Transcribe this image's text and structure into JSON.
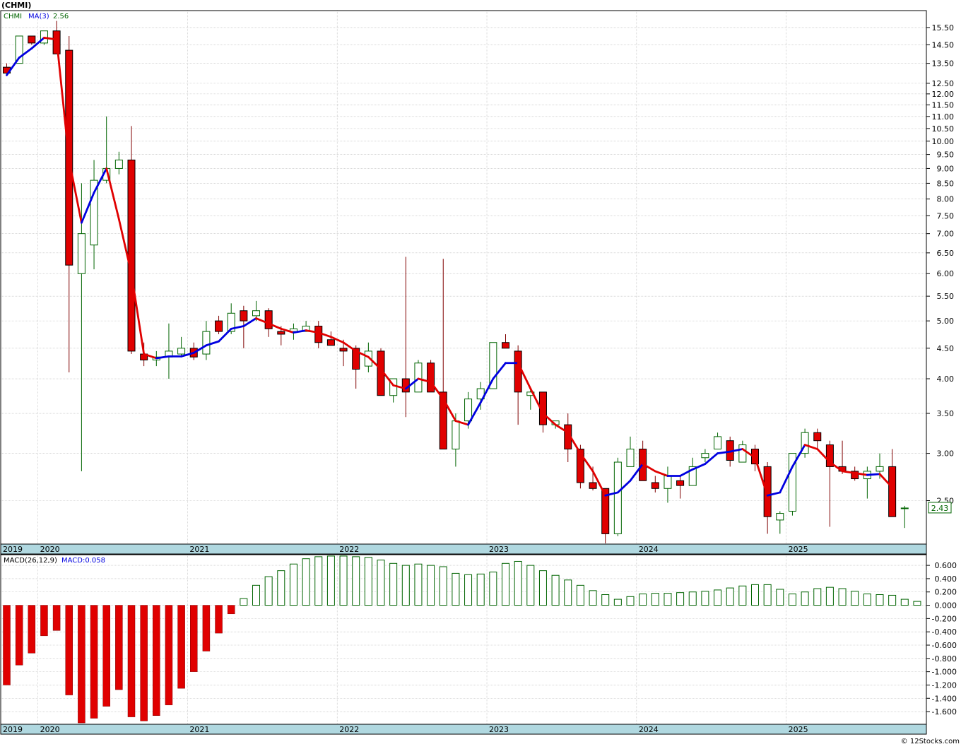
{
  "title": "(CHMI)",
  "price_legend": {
    "symbol": "CHMI",
    "ma_label": "MA(3)",
    "ma_value": "2.56"
  },
  "macd_legend": {
    "label": "MACD(26,12,9)",
    "value_label": "MACD:0.058"
  },
  "last_price": "2.43",
  "watermark": "© 12Stocks.com",
  "colors": {
    "up_body": "#ffffff",
    "up_outline": "#006400",
    "down_body": "#e00000",
    "ma_up": "#0000e0",
    "ma_down": "#e00000",
    "macd_up_outline": "#006400",
    "macd_down": "#e00000",
    "axis_band": "#b0d8e0",
    "grid": "#c0c0c0"
  },
  "chart_data": [
    {
      "type": "candlestick",
      "scale": "log",
      "ylim": [
        2.12,
        16.5
      ],
      "y_ticks": [
        "2.50",
        "3.00",
        "3.50",
        "4.00",
        "4.50",
        "5.00",
        "5.50",
        "6.00",
        "6.50",
        "7.00",
        "7.50",
        "8.00",
        "8.50",
        "9.00",
        "9.50",
        "10.00",
        "10.50",
        "11.00",
        "11.50",
        "12.00",
        "12.50",
        "13.50",
        "14.50",
        "15.50"
      ],
      "x_labels": [
        "2019",
        "2020",
        "2021",
        "2022",
        "2023",
        "2024",
        "2025"
      ],
      "x_label_month_index": [
        0,
        3,
        15,
        27,
        39,
        51,
        63
      ],
      "grid": true,
      "interval": "monthly",
      "candles": [
        [
          13.3,
          13.5,
          13.0,
          13.0
        ],
        [
          13.5,
          15.0,
          13.5,
          15.0
        ],
        [
          15.0,
          15.0,
          14.5,
          14.6
        ],
        [
          14.6,
          15.3,
          14.5,
          15.3
        ],
        [
          15.3,
          15.9,
          14.0,
          14.0
        ],
        [
          14.2,
          15.0,
          4.1,
          6.2
        ],
        [
          6.0,
          8.5,
          2.8,
          7.0
        ],
        [
          6.7,
          9.3,
          6.1,
          8.6
        ],
        [
          8.6,
          11.0,
          8.5,
          9.0
        ],
        [
          9.0,
          9.6,
          8.8,
          9.3
        ],
        [
          9.3,
          10.6,
          4.4,
          4.45
        ],
        [
          4.4,
          4.6,
          4.2,
          4.3
        ],
        [
          4.3,
          4.45,
          4.2,
          4.35
        ],
        [
          4.35,
          4.95,
          4.0,
          4.45
        ],
        [
          4.4,
          4.7,
          4.35,
          4.5
        ],
        [
          4.5,
          4.6,
          4.3,
          4.35
        ],
        [
          4.4,
          5.0,
          4.3,
          4.8
        ],
        [
          5.0,
          5.1,
          4.75,
          4.8
        ],
        [
          4.8,
          5.35,
          4.75,
          5.15
        ],
        [
          5.2,
          5.3,
          4.5,
          5.0
        ],
        [
          5.1,
          5.4,
          5.0,
          5.2
        ],
        [
          5.2,
          5.25,
          4.7,
          4.85
        ],
        [
          4.8,
          4.9,
          4.55,
          4.75
        ],
        [
          4.8,
          4.95,
          4.65,
          4.85
        ],
        [
          4.8,
          5.0,
          4.8,
          4.9
        ],
        [
          4.9,
          5.0,
          4.5,
          4.6
        ],
        [
          4.65,
          4.8,
          4.55,
          4.55
        ],
        [
          4.5,
          4.65,
          4.2,
          4.45
        ],
        [
          4.5,
          4.55,
          3.85,
          4.15
        ],
        [
          4.2,
          4.6,
          4.1,
          4.45
        ],
        [
          4.45,
          4.5,
          3.75,
          3.75
        ],
        [
          3.75,
          4.0,
          3.65,
          4.0
        ],
        [
          4.0,
          6.4,
          3.45,
          3.8
        ],
        [
          3.8,
          4.3,
          3.8,
          4.25
        ],
        [
          4.25,
          4.3,
          3.8,
          3.8
        ],
        [
          3.8,
          6.35,
          3.05,
          3.05
        ],
        [
          3.05,
          3.5,
          2.85,
          3.4
        ],
        [
          3.4,
          3.8,
          3.3,
          3.7
        ],
        [
          3.7,
          3.95,
          3.55,
          3.85
        ],
        [
          3.85,
          4.6,
          3.85,
          4.6
        ],
        [
          4.6,
          4.75,
          4.5,
          4.5
        ],
        [
          4.45,
          4.55,
          3.35,
          3.8
        ],
        [
          3.75,
          3.85,
          3.55,
          3.8
        ],
        [
          3.8,
          3.8,
          3.25,
          3.35
        ],
        [
          3.35,
          3.4,
          3.3,
          3.4
        ],
        [
          3.35,
          3.5,
          2.9,
          3.05
        ],
        [
          3.05,
          3.1,
          2.62,
          2.68
        ],
        [
          2.68,
          2.85,
          2.6,
          2.62
        ],
        [
          2.62,
          2.62,
          2.12,
          2.2
        ],
        [
          2.2,
          2.95,
          2.18,
          2.9
        ],
        [
          2.85,
          3.2,
          2.85,
          3.05
        ],
        [
          3.05,
          3.15,
          2.7,
          2.7
        ],
        [
          2.68,
          2.75,
          2.58,
          2.62
        ],
        [
          2.62,
          2.85,
          2.48,
          2.75
        ],
        [
          2.7,
          2.75,
          2.52,
          2.65
        ],
        [
          2.65,
          2.95,
          2.65,
          2.85
        ],
        [
          2.95,
          3.05,
          2.9,
          3.0
        ],
        [
          3.05,
          3.25,
          3.05,
          3.2
        ],
        [
          3.15,
          3.2,
          2.85,
          2.92
        ],
        [
          2.9,
          3.15,
          2.9,
          3.1
        ],
        [
          3.05,
          3.1,
          2.8,
          2.88
        ],
        [
          2.85,
          2.9,
          2.2,
          2.35
        ],
        [
          2.32,
          2.4,
          2.2,
          2.38
        ],
        [
          2.4,
          3.0,
          2.36,
          3.0
        ],
        [
          3.0,
          3.3,
          2.95,
          3.25
        ],
        [
          3.25,
          3.3,
          3.05,
          3.15
        ],
        [
          3.1,
          3.15,
          2.26,
          2.85
        ],
        [
          2.85,
          3.15,
          2.77,
          2.8
        ],
        [
          2.8,
          2.85,
          2.7,
          2.72
        ],
        [
          2.72,
          2.85,
          2.52,
          2.8
        ],
        [
          2.8,
          3.0,
          2.72,
          2.85
        ],
        [
          2.85,
          3.05,
          2.35,
          2.35
        ],
        [
          2.43,
          2.45,
          2.25,
          2.43
        ]
      ],
      "ma3": [
        12.9,
        13.8,
        14.3,
        14.9,
        14.8,
        9.3,
        7.3,
        8.2,
        9.0,
        7.4,
        6.0,
        4.4,
        4.33,
        4.36,
        4.36,
        4.42,
        4.55,
        4.62,
        4.85,
        4.9,
        5.05,
        4.95,
        4.85,
        4.78,
        4.82,
        4.78,
        4.7,
        4.6,
        4.45,
        4.35,
        4.15,
        3.9,
        3.85,
        4.0,
        3.95,
        3.7,
        3.4,
        3.35,
        3.65,
        4.0,
        4.25,
        4.25,
        3.85,
        3.5,
        3.35,
        3.25,
        3.0,
        2.8,
        2.55,
        2.58,
        2.7,
        2.88,
        2.8,
        2.75,
        2.75,
        2.82,
        2.88,
        3.0,
        3.02,
        3.05,
        2.95,
        2.55,
        2.58,
        2.85,
        3.1,
        3.05,
        2.9,
        2.8,
        2.78,
        2.76,
        2.77,
        2.63,
        null
      ]
    },
    {
      "type": "bar",
      "title": "MACD(26,12,9)",
      "ylim": [
        -1.78,
        0.75
      ],
      "y_ticks": [
        "0.600",
        "0.400",
        "0.200",
        "0.000",
        "-0.200",
        "-0.400",
        "-0.600",
        "-0.800",
        "-1.000",
        "-1.200",
        "-1.400",
        "-1.600"
      ],
      "x_labels": [
        "2019",
        "2020",
        "2021",
        "2022",
        "2023",
        "2024",
        "2025"
      ],
      "values": [
        -1.2,
        -0.9,
        -0.72,
        -0.46,
        -0.38,
        -1.35,
        -1.77,
        -1.7,
        -1.52,
        -1.27,
        -1.68,
        -1.74,
        -1.66,
        -1.5,
        -1.25,
        -1.0,
        -0.69,
        -0.42,
        -0.13,
        0.1,
        0.3,
        0.43,
        0.52,
        0.62,
        0.7,
        0.73,
        0.74,
        0.74,
        0.73,
        0.72,
        0.68,
        0.63,
        0.6,
        0.62,
        0.6,
        0.58,
        0.48,
        0.46,
        0.47,
        0.5,
        0.63,
        0.66,
        0.6,
        0.52,
        0.45,
        0.38,
        0.3,
        0.22,
        0.16,
        0.09,
        0.13,
        0.17,
        0.18,
        0.18,
        0.19,
        0.2,
        0.21,
        0.23,
        0.26,
        0.29,
        0.31,
        0.31,
        0.24,
        0.17,
        0.2,
        0.25,
        0.27,
        0.25,
        0.21,
        0.17,
        0.16,
        0.15,
        0.09,
        0.058
      ]
    }
  ]
}
